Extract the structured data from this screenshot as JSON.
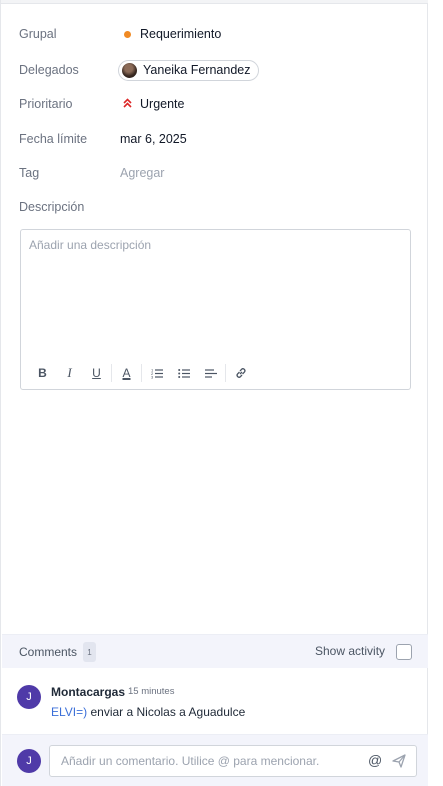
{
  "fields": {
    "grupal": {
      "label": "Grupal",
      "value": "Requerimiento",
      "dot_color": "#f08a24"
    },
    "delegados": {
      "label": "Delegados",
      "value": "Yaneika Fernandez"
    },
    "prioritario": {
      "label": "Prioritario",
      "value": "Urgente",
      "icon": "double-chevron-up-icon",
      "icon_color": "#dc2626"
    },
    "fecha_limite": {
      "label": "Fecha límite",
      "value": "mar 6, 2025"
    },
    "tag": {
      "label": "Tag",
      "placeholder": "Agregar"
    },
    "descripcion": {
      "label": "Descripción"
    }
  },
  "editor": {
    "placeholder": "Añadir una descripción",
    "toolbar": [
      "bold",
      "italic",
      "underline",
      "text-color",
      "ordered-list",
      "bullet-list",
      "align",
      "link"
    ]
  },
  "comments": {
    "title": "Comments",
    "count": "1",
    "show_activity_label": "Show activity",
    "show_activity_checked": false,
    "items": [
      {
        "avatar_initial": "J",
        "author": "Montacargas",
        "time": "15 minutes",
        "mention": "ELVI=)",
        "text": " enviar a Nicolas a Aguadulce"
      }
    ]
  },
  "composer": {
    "avatar_initial": "J",
    "placeholder": "Añadir un comentario. Utilice @ para mencionar."
  },
  "colors": {
    "accent_avatar": "#4f3aa8",
    "mention": "#3b6fd8"
  }
}
